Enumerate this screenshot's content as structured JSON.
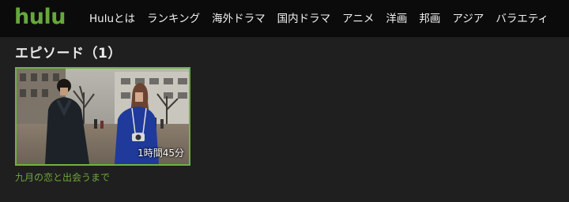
{
  "header": {
    "logo": "hulu",
    "nav": [
      "Huluとは",
      "ランキング",
      "海外ドラマ",
      "国内ドラマ",
      "アニメ",
      "洋画",
      "邦画",
      "アジア",
      "バラエティ"
    ]
  },
  "section": {
    "title": "エピソード（1）"
  },
  "episodes": [
    {
      "duration": "1時間45分",
      "title": "九月の恋と出会うまで"
    }
  ],
  "colors": {
    "brand": "#6fb33f",
    "topbar": "#0b0b0c",
    "background": "#1f1f20"
  }
}
